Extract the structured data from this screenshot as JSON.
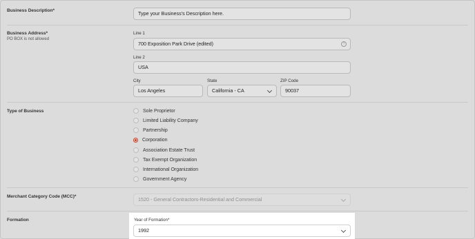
{
  "business_description": {
    "label": "Business Description*",
    "placeholder": "Type your Business's Description here."
  },
  "business_address": {
    "label": "Business Address*",
    "note": "PO BOX is not allowed",
    "line1_label": "Line 1",
    "line1_value": "700 Exposition Park Drive (edited)",
    "line2_label": "Line 2",
    "line2_value": "USA",
    "city_label": "City",
    "city_value": "Los Angeles",
    "state_label": "State",
    "state_value": "California - CA",
    "zip_label": "ZIP Code",
    "zip_value": "90037"
  },
  "type_of_business": {
    "label": "Type of Business",
    "options": [
      "Sole Proprietor",
      "Limited Liability Company",
      "Partnership",
      "Corporation",
      "Association Estate Trust",
      "Tax Exempt Organization",
      "International Organization",
      "Government Agency"
    ],
    "selected": "Corporation"
  },
  "mcc": {
    "label": "Merchant Category Code (MCC)*",
    "value": "1520 - General Contractors-Residential and Commercial"
  },
  "formation": {
    "label": "Formation",
    "year_label": "Year of Formation*",
    "year_value": "1992"
  },
  "colors": {
    "accent": "#d0371c",
    "background": "#dcdcdc"
  }
}
